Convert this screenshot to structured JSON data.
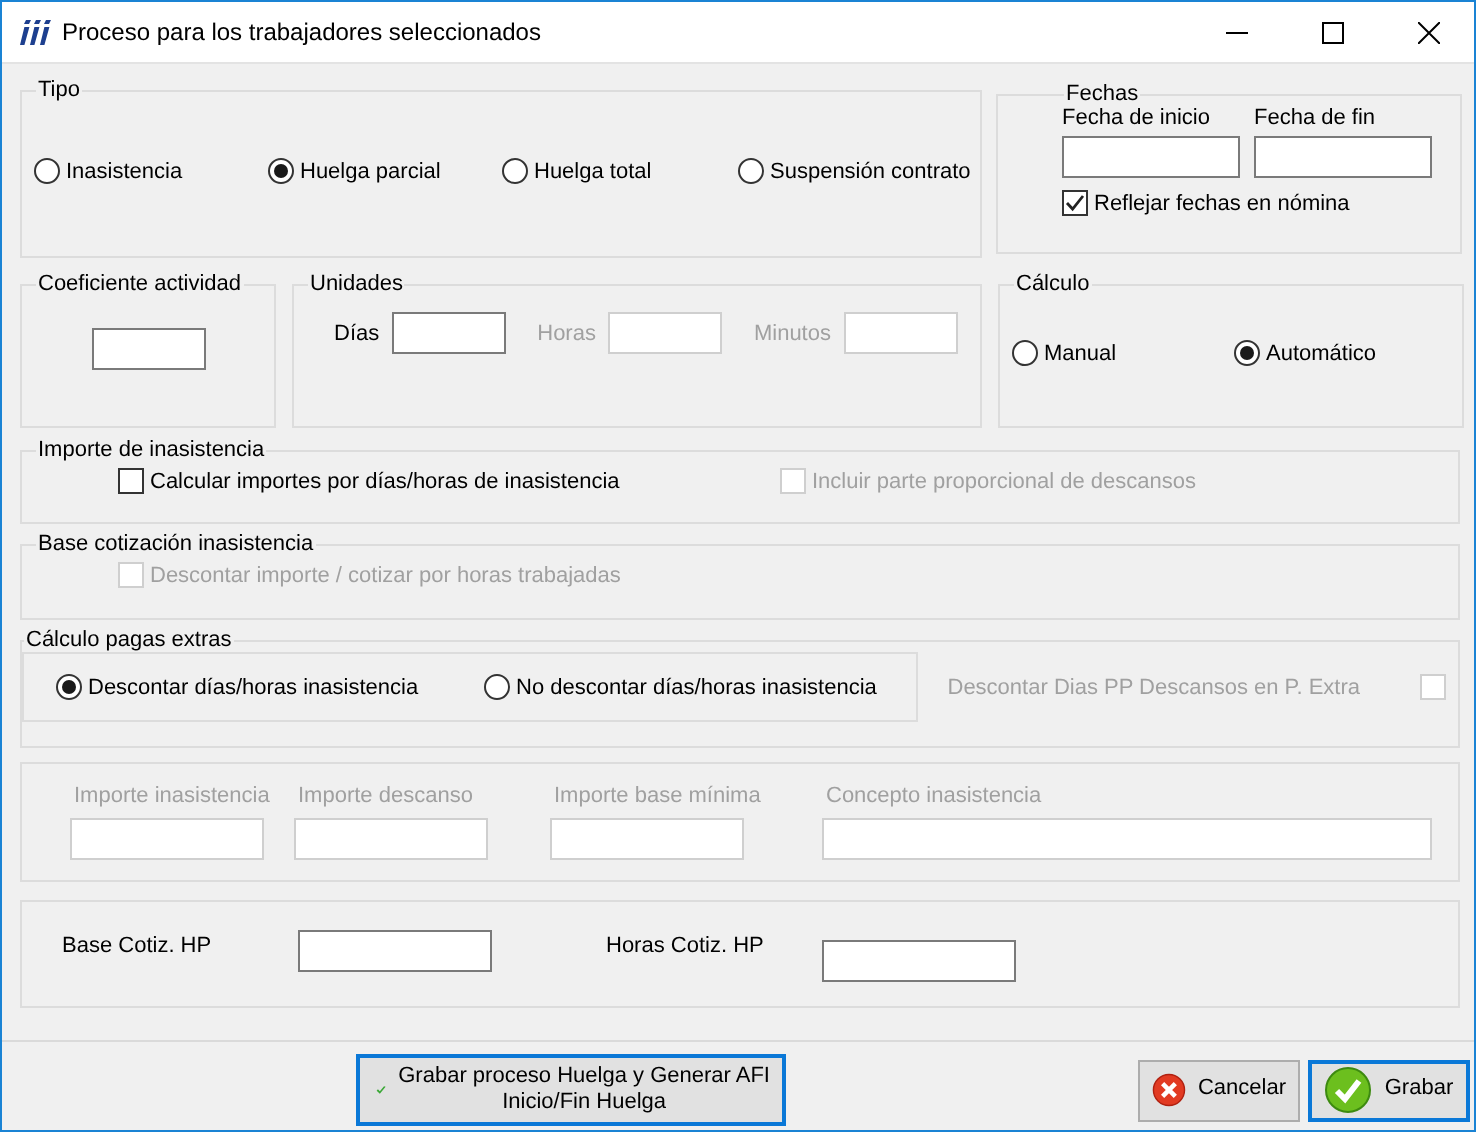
{
  "window": {
    "title": "Proceso para los trabajadores seleccionados"
  },
  "tipo": {
    "label": "Tipo",
    "options": [
      {
        "label": "Inasistencia",
        "selected": false
      },
      {
        "label": "Huelga parcial",
        "selected": true
      },
      {
        "label": "Huelga total",
        "selected": false
      },
      {
        "label": "Suspensión contrato",
        "selected": false
      }
    ]
  },
  "fechas": {
    "label": "Fechas",
    "fields": [
      {
        "label": "Fecha de inicio"
      },
      {
        "label": "Fecha de fin"
      }
    ],
    "reflect": {
      "label": "Reflejar fechas en nómina",
      "checked": true
    }
  },
  "coeficiente": {
    "label": "Coeficiente actividad"
  },
  "unidades": {
    "label": "Unidades",
    "fields": [
      {
        "label": "Días",
        "disabled": false
      },
      {
        "label": "Horas",
        "disabled": true
      },
      {
        "label": "Minutos",
        "disabled": true
      }
    ]
  },
  "calculo": {
    "label": "Cálculo",
    "options": [
      {
        "label": "Manual",
        "selected": false
      },
      {
        "label": "Automático",
        "selected": true
      }
    ]
  },
  "importe_inasistencia": {
    "label": "Importe de inasistencia",
    "checkboxes": [
      {
        "label": "Calcular importes por días/horas de inasistencia",
        "checked": false,
        "disabled": false
      },
      {
        "label": "Incluir parte proporcional de descansos",
        "checked": false,
        "disabled": true
      }
    ]
  },
  "base_cotizacion": {
    "label": "Base cotización inasistencia",
    "checkbox": {
      "label": "Descontar importe / cotizar por horas trabajadas",
      "checked": false,
      "disabled": true
    }
  },
  "pagas_extras": {
    "label": "Cálculo pagas extras",
    "options": [
      {
        "label": "Descontar días/horas inasistencia",
        "selected": true
      },
      {
        "label": "No descontar días/horas inasistencia",
        "selected": false
      }
    ],
    "checkbox": {
      "label": "Descontar Dias PP Descansos en P. Extra",
      "checked": false,
      "disabled": true
    }
  },
  "importes": {
    "fields": [
      {
        "label": "Importe inasistencia",
        "disabled": true
      },
      {
        "label": "Importe descanso",
        "disabled": true
      },
      {
        "label": "Importe base mínima",
        "disabled": true
      },
      {
        "label": "Concepto inasistencia",
        "disabled": true
      }
    ]
  },
  "hp": {
    "fields": [
      {
        "label": "Base Cotiz. HP"
      },
      {
        "label": "Horas Cotiz. HP"
      }
    ]
  },
  "buttons": [
    {
      "label": "Grabar proceso Huelga y Generar AFI\nInicio/Fin Huelga",
      "kind": "check",
      "focused": true
    },
    {
      "label": "Cancelar",
      "kind": "cancel",
      "focused": false
    },
    {
      "label": "Grabar",
      "kind": "ok",
      "focused": true
    }
  ]
}
